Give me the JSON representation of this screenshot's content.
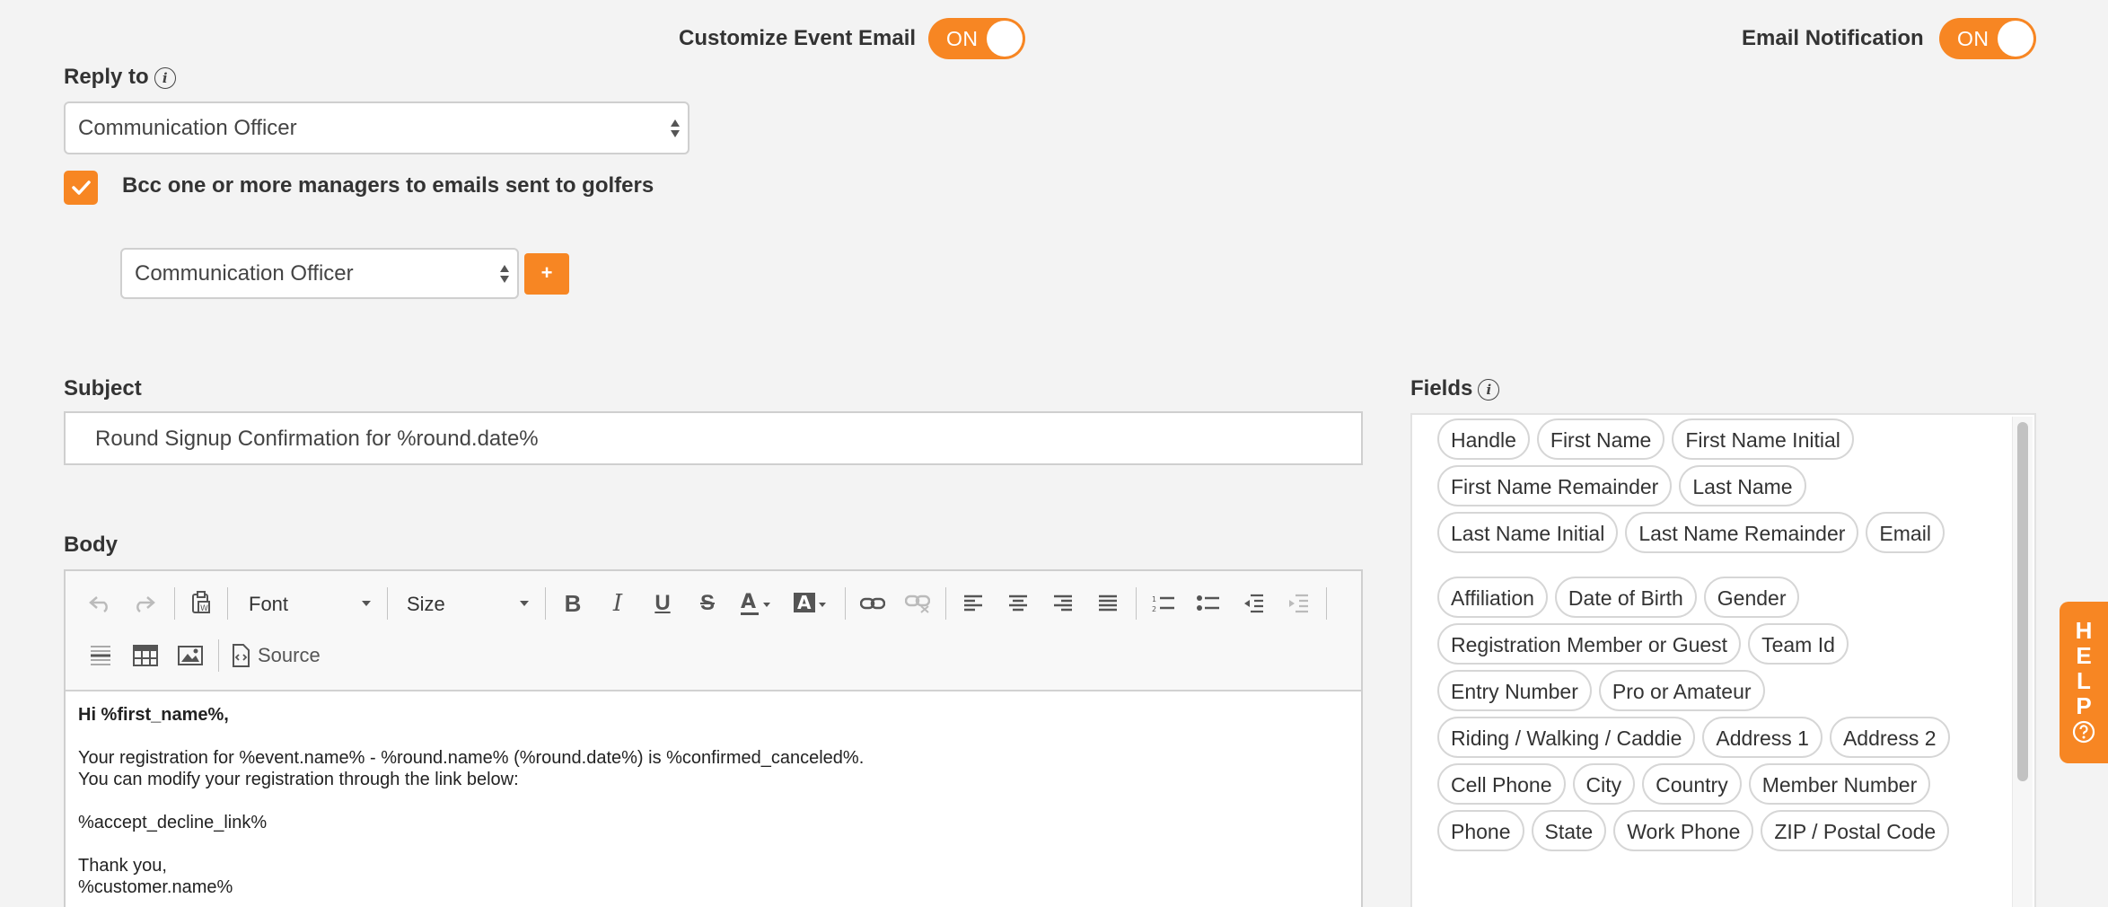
{
  "header": {
    "customize_event_email": {
      "label": "Customize Event Email",
      "toggle": "ON"
    },
    "email_notification": {
      "label": "Email Notification",
      "toggle": "ON"
    }
  },
  "reply_to": {
    "label": "Reply to",
    "value": "Communication Officer"
  },
  "bcc": {
    "checked": true,
    "label": "Bcc one or more managers to emails sent to golfers",
    "manager_value": "Communication Officer",
    "add_label": "+"
  },
  "subject": {
    "label": "Subject",
    "value": "Round Signup Confirmation for %round.date%"
  },
  "body": {
    "label": "Body",
    "toolbar": {
      "font": "Font",
      "size": "Size",
      "source": "Source"
    },
    "content": {
      "greeting": "Hi %first_name%,",
      "line1": "Your registration for %event.name% - %round.name% (%round.date%) is %confirmed_canceled%.",
      "line2": "You can modify your registration through the link below:",
      "link": "%accept_decline_link%",
      "thanks": "Thank you,",
      "signature": "%customer.name%"
    }
  },
  "fields": {
    "label": "Fields",
    "group1": [
      "Handle",
      "First Name",
      "First Name Initial",
      "First Name Remainder",
      "Last Name",
      "Last Name Initial",
      "Last Name Remainder",
      "Email"
    ],
    "group2": [
      "Affiliation",
      "Date of Birth",
      "Gender",
      "Registration Member or Guest",
      "Team Id",
      "Entry Number",
      "Pro or Amateur",
      "Riding / Walking / Caddie",
      "Address 1",
      "Address 2",
      "Cell Phone",
      "City",
      "Country",
      "Member Number",
      "Phone",
      "State",
      "Work Phone",
      "ZIP / Postal Code"
    ]
  },
  "help": {
    "letters": [
      "H",
      "E",
      "L",
      "P"
    ]
  },
  "colors": {
    "accent": "#f78623",
    "background": "#f3f3f3"
  }
}
